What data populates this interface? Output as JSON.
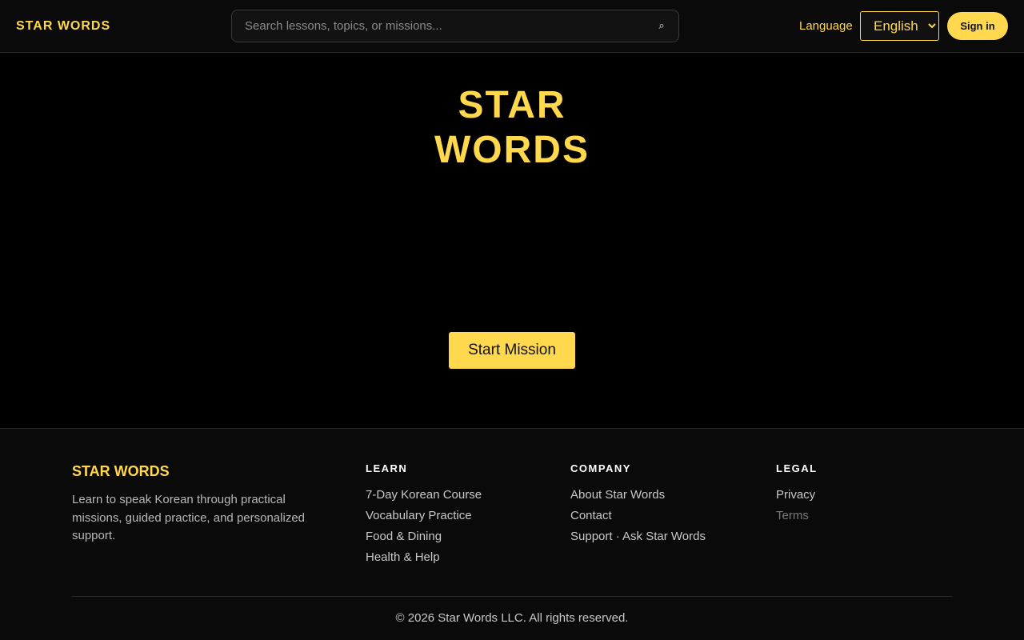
{
  "header": {
    "brand": "STAR WORDS",
    "search_placeholder": "Search lessons, topics, or missions...",
    "search_icon": "⌕",
    "language_label": "Language",
    "language_selected": "English",
    "sign_in_label": "Sign in"
  },
  "hero": {
    "title_line1": "STAR",
    "title_line2": "WORDS",
    "start_label": "Start Mission"
  },
  "footer": {
    "brand": "STAR WORDS",
    "description": "Learn to speak Korean through practical missions, guided practice, and personalized support.",
    "columns": [
      {
        "heading": "LEARN",
        "links": [
          "7-Day Korean Course",
          "Vocabulary Practice",
          "Food & Dining",
          "Health & Help"
        ]
      },
      {
        "heading": "COMPANY",
        "links": [
          "About Star Words",
          "Contact",
          "Support · Ask Star Words"
        ]
      },
      {
        "heading": "LEGAL",
        "links": [
          "Privacy",
          "Terms"
        ]
      }
    ],
    "copyright": "© 2026 Star Words LLC. All rights reserved."
  },
  "colors": {
    "accent": "#ffd84d",
    "background": "#000000",
    "panel": "#0a0a0a"
  }
}
